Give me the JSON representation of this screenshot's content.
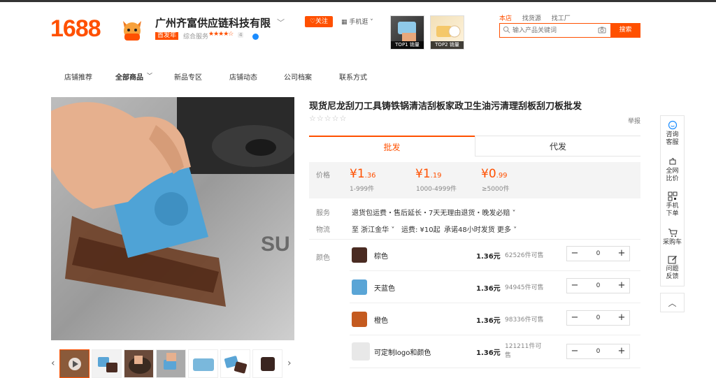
{
  "header": {
    "logo": "1688",
    "shop_name": "广州齐富供应链科技有限",
    "years_badge": "首发年",
    "rating_label": "综合服务",
    "rating_stars": "★★★★☆",
    "rating_score": "4",
    "follow": "♡关注",
    "mobile": "手机逛 ˅",
    "top_products": [
      {
        "caption": "TOP1 销量"
      },
      {
        "caption": "TOP2 销量"
      }
    ],
    "search_tabs": [
      "本店",
      "找货源",
      "找工厂"
    ],
    "search_placeholder": "输入产品关键词",
    "search_button": "搜索"
  },
  "nav": {
    "items": [
      "店铺推荐",
      "全部商品",
      "新品专区",
      "店铺动态",
      "公司档案",
      "联系方式"
    ]
  },
  "product": {
    "title": "现货尼龙刮刀工具铸铁锅清洁刮板家政卫生油污清理刮板刮刀板批发",
    "stars": "☆☆☆☆☆",
    "report": "举报",
    "tabs": [
      "批发",
      "代发"
    ],
    "price_label": "价格",
    "tiers": [
      {
        "int": "¥1",
        "dec": ".36",
        "range": "1-999件"
      },
      {
        "int": "¥1",
        "dec": ".19",
        "range": "1000-4999件"
      },
      {
        "int": "¥0",
        "dec": ".99",
        "range": "≥5000件"
      }
    ],
    "service_label": "服务",
    "service_value": "退货包运费・售后延长・7天无理由退货・晚发必赔 ˅",
    "logistics_label": "物流",
    "logistics_dest": "至 浙江金华 ˅",
    "logistics_fee": "运费: ¥10起",
    "logistics_promise": "承诺48小时发货 更多 ˅",
    "color_label": "颜色",
    "skus": [
      {
        "name": "棕色",
        "price": "1.36元",
        "stock": "62526件可售",
        "qty": "0"
      },
      {
        "name": "天蓝色",
        "price": "1.36元",
        "stock": "94945件可售",
        "qty": "0"
      },
      {
        "name": "橙色",
        "price": "1.36元",
        "stock": "98336件可售",
        "qty": "0"
      },
      {
        "name": "可定制logo和颜色",
        "price": "1.36元",
        "stock": "121211件可售",
        "qty": "0"
      }
    ]
  },
  "sidebar": {
    "items": [
      "咨询客服",
      "全网比价",
      "手机下单",
      "采购车",
      "问题反馈"
    ],
    "top": "︿"
  },
  "colors": {
    "accent": "#ff5000",
    "brown": "#4a2b22",
    "sky_blue": "#5aa5d6",
    "orange": "#c45a1f"
  }
}
